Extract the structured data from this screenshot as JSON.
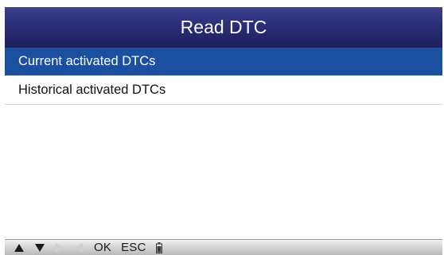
{
  "header": {
    "title": "Read DTC"
  },
  "menu": {
    "items": [
      {
        "label": "Current activated DTCs",
        "selected": true
      },
      {
        "label": "Historical activated DTCs",
        "selected": false
      }
    ]
  },
  "footer": {
    "keys": [
      {
        "icon": "up-arrow-icon",
        "enabled": true
      },
      {
        "icon": "down-arrow-icon",
        "enabled": true
      },
      {
        "icon": "right-arrow-icon",
        "enabled": false
      },
      {
        "icon": "left-arrow-icon",
        "enabled": false
      }
    ],
    "ok_label": "OK",
    "esc_label": "ESC",
    "battery_icon": "battery-icon"
  },
  "colors": {
    "title_bar": "#2b2e78",
    "selected_row": "#1b4fa0",
    "footer_bar": "#d0d0d0"
  }
}
